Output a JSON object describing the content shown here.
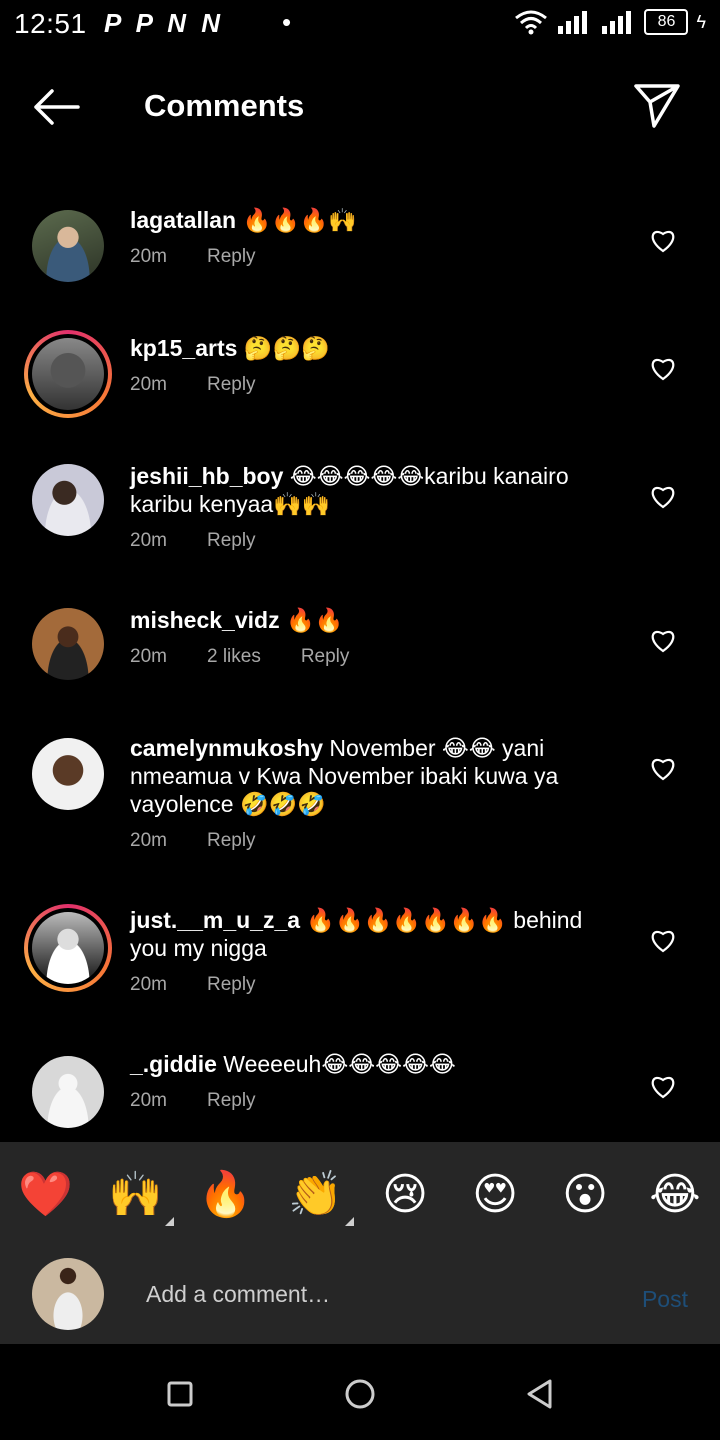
{
  "status_bar": {
    "time": "12:51",
    "notifications": "P P N N",
    "dot": "•",
    "battery": "86",
    "bolt": "ϟ"
  },
  "header": {
    "title": "Comments",
    "back_icon": "arrow-left-icon",
    "share_icon": "paper-plane-icon"
  },
  "comments": [
    {
      "username": "lagatallan",
      "text": " 🔥🔥🔥🙌",
      "time": "20m",
      "likes": "",
      "reply": "Reply",
      "avatar": "photo"
    },
    {
      "username": "kp15_arts",
      "text": " 🤔🤔🤔",
      "time": "20m",
      "likes": "",
      "reply": "Reply",
      "avatar": "photo-story-ring"
    },
    {
      "username": "jeshii_hb_boy",
      "text": " 😂😂😂😂😂karibu kanairo karibu kenyaa🙌🙌",
      "time": "20m",
      "likes": "",
      "reply": "Reply",
      "avatar": "photo"
    },
    {
      "username": "misheck_vidz",
      "text": " 🔥🔥",
      "time": "20m",
      "likes": "2 likes",
      "reply": "Reply",
      "avatar": "photo"
    },
    {
      "username": "camelynmukoshy",
      "text": " November 😂😂 yani nmeamua v Kwa November ibaki kuwa ya vayolence 🤣🤣🤣",
      "time": "20m",
      "likes": "",
      "reply": "Reply",
      "avatar": "photo"
    },
    {
      "username": "just.__m_u_z_a",
      "text": " 🔥🔥🔥🔥🔥🔥🔥 behind you my nigga",
      "time": "20m",
      "likes": "",
      "reply": "Reply",
      "avatar": "photo-story-ring"
    },
    {
      "username": "_.giddie",
      "text": " Weeeeuh😂😂😂😂😂",
      "time": "20m",
      "likes": "",
      "reply": "Reply",
      "avatar": "default-grey"
    }
  ],
  "reactions": [
    {
      "emoji": "❤️",
      "icon": "red-heart-emoji",
      "has_variants": false
    },
    {
      "emoji": "🙌",
      "icon": "raising-hands-emoji",
      "has_variants": true
    },
    {
      "emoji": "🔥",
      "icon": "fire-emoji",
      "has_variants": false
    },
    {
      "emoji": "👏",
      "icon": "clapping-hands-emoji",
      "has_variants": true
    },
    {
      "emoji": "😢",
      "icon": "crying-face-emoji",
      "has_variants": false
    },
    {
      "emoji": "😍",
      "icon": "heart-eyes-emoji",
      "has_variants": false
    },
    {
      "emoji": "😮",
      "icon": "open-mouth-emoji",
      "has_variants": false
    },
    {
      "emoji": "😂",
      "icon": "tears-of-joy-emoji",
      "has_variants": false
    }
  ],
  "composer": {
    "placeholder": "Add a comment…",
    "post_label": "Post"
  },
  "colors": {
    "background": "#000000",
    "panel": "#262626",
    "meta_text": "#a8a8a8",
    "post_disabled": "#1e4e78",
    "story_ring": "#e1306c"
  }
}
